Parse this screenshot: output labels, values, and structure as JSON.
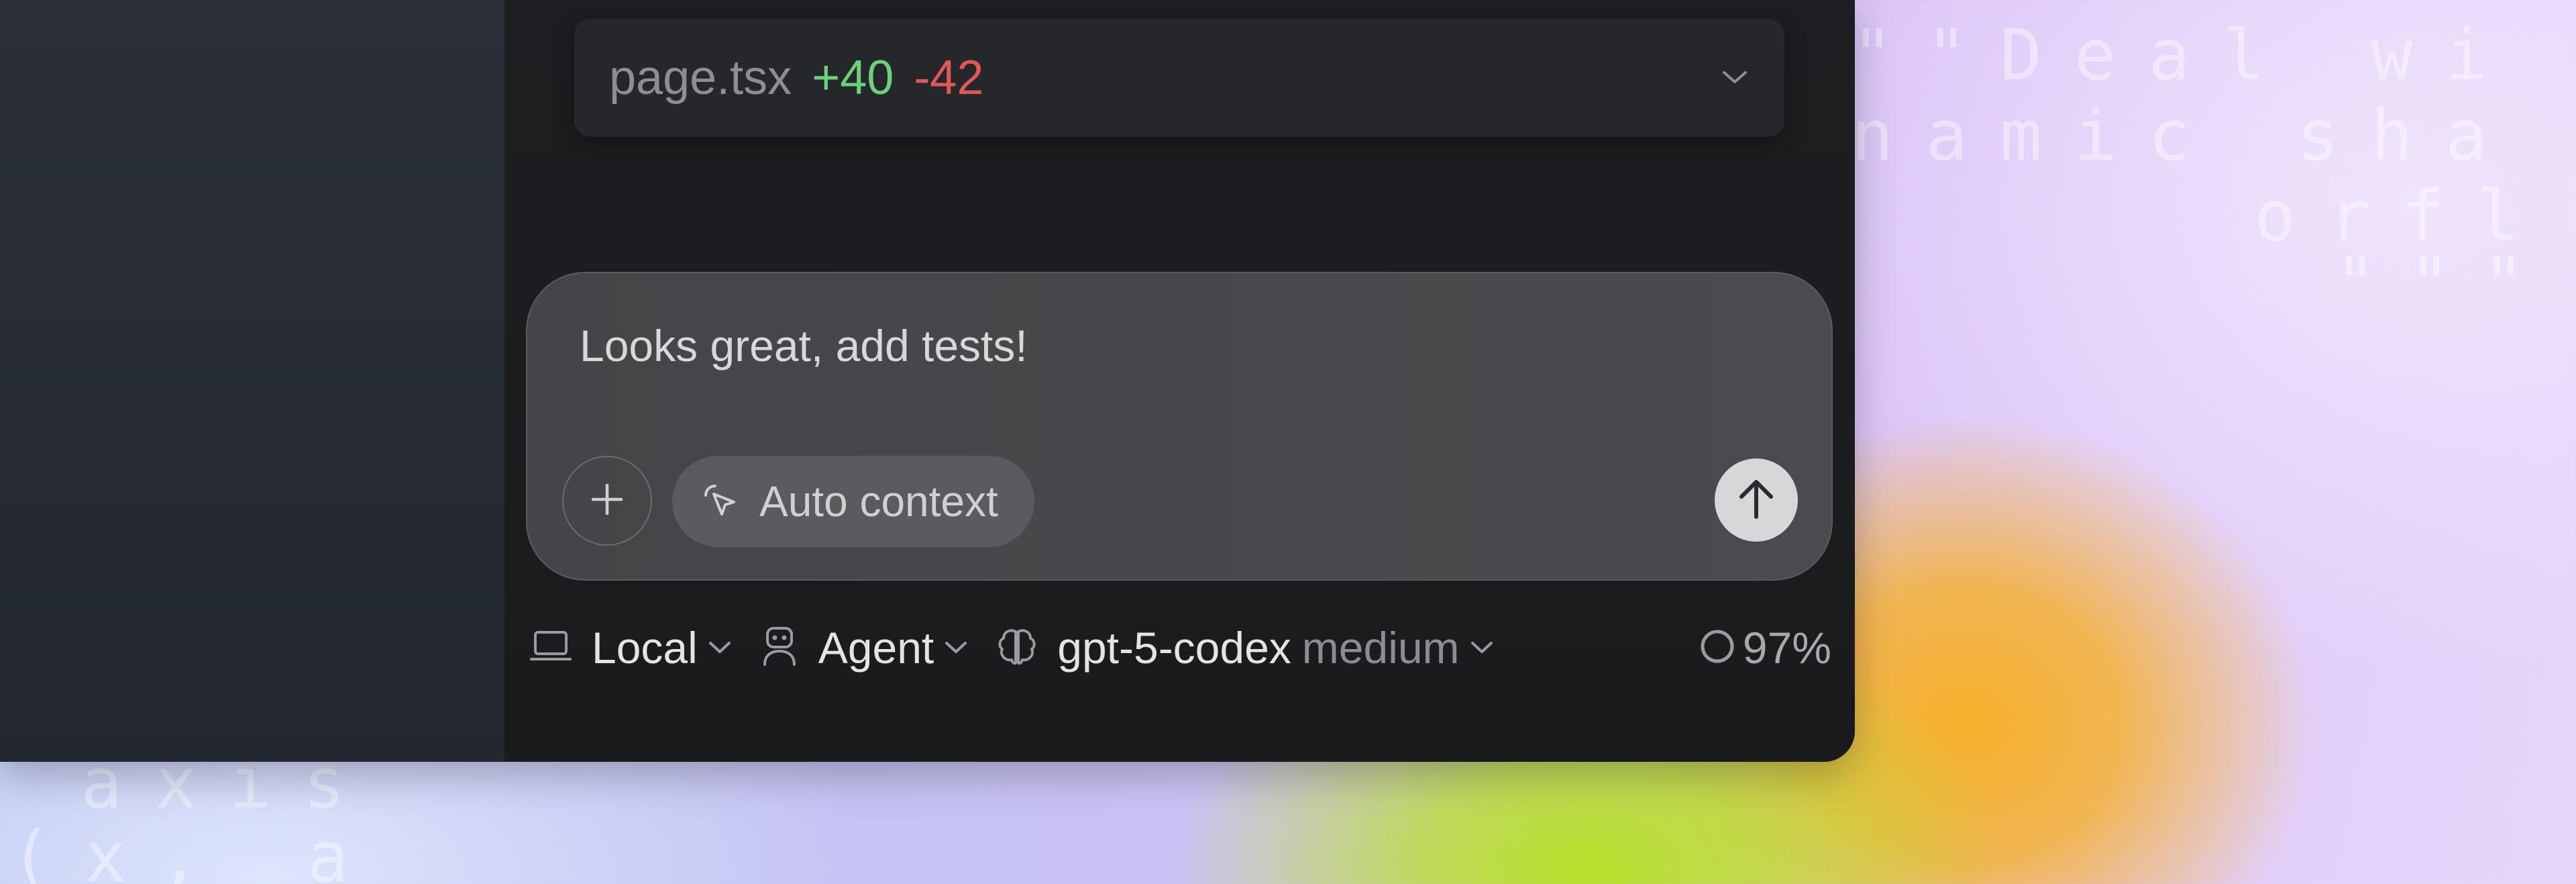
{
  "background_code": {
    "line1": "\"\"Deal wi",
    "line2": "namic sha",
    "line3": "orfl",
    "line4": "\"\"\"",
    "line5": "axis",
    "line6": "(x, a"
  },
  "file_card": {
    "filename": "page.tsx",
    "additions": "+40",
    "deletions": "-42",
    "expand_icon": "chevron-down-icon"
  },
  "composer": {
    "message": "Looks great, add tests!",
    "add_icon": "plus-icon",
    "context_icon": "cursor-click-icon",
    "context_label": "Auto context",
    "send_icon": "arrow-up-icon"
  },
  "toolbar": {
    "environment_icon": "laptop-icon",
    "environment_label": "Local",
    "mode_icon": "robot-icon",
    "mode_label": "Agent",
    "model_icon": "brain-icon",
    "model_label": "gpt-5-codex",
    "reasoning_label": "medium",
    "context_usage_icon": "progress-ring-icon",
    "context_usage": "97%",
    "context_usage_fraction": 0.97
  },
  "colors": {
    "additions": "#6ed07d",
    "deletions": "#e05757",
    "window_bg": "#1c1d20",
    "sidebar_bg": "#2a2f38"
  }
}
